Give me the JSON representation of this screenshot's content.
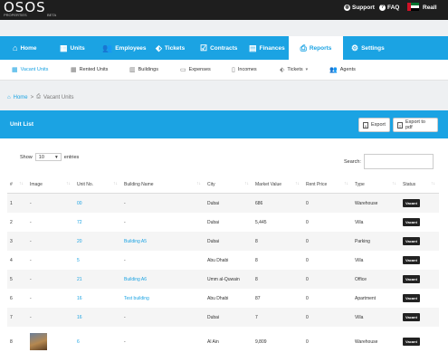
{
  "topbar": {
    "logo": "OSOS",
    "logo_sub": "PROPERTIES",
    "logo_badge": "BETA",
    "support": "Support",
    "faq": "FAQ",
    "user": "Reall"
  },
  "main_nav": [
    {
      "label": "Home",
      "icon": "home-icon"
    },
    {
      "label": "Units",
      "icon": "building-icon"
    },
    {
      "label": "Employees",
      "icon": "users-icon"
    },
    {
      "label": "Tickets",
      "icon": "tag-icon"
    },
    {
      "label": "Contracts",
      "icon": "clipboard-check-icon"
    },
    {
      "label": "Finances",
      "icon": "finance-icon"
    },
    {
      "label": "Reports",
      "icon": "printer-icon",
      "active": true
    },
    {
      "label": "Settings",
      "icon": "gear-icon"
    }
  ],
  "sub_nav": [
    {
      "label": "Vacant Units",
      "active": true
    },
    {
      "label": "Rented Units"
    },
    {
      "label": "Buildings"
    },
    {
      "label": "Expenses"
    },
    {
      "label": "Incomes"
    },
    {
      "label": "Tickets"
    },
    {
      "label": "Agents"
    }
  ],
  "breadcrumb": {
    "home": "Home",
    "separator": ">",
    "current": "Vacant Units"
  },
  "panel": {
    "title": "Unit List",
    "export_label": "Export",
    "export_pdf_label": "Export to pdf",
    "show_label": "Show",
    "entries_value": "10",
    "entries_label": "entries",
    "search_label": "Search:"
  },
  "table": {
    "headers": [
      "#",
      "Image",
      "Unit No.",
      "Building Name",
      "City",
      "Market Value",
      "Rent Price",
      "Type",
      "Status"
    ],
    "rows": [
      {
        "num": "1",
        "image": "-",
        "unit": "00",
        "building": "-",
        "city": "Dubai",
        "market": "686",
        "rent": "0",
        "type": "Warehouse",
        "status": "Vacant"
      },
      {
        "num": "2",
        "image": "-",
        "unit": "72",
        "building": "-",
        "city": "Dubai",
        "market": "5,445",
        "rent": "0",
        "type": "Villa",
        "status": "Vacant"
      },
      {
        "num": "3",
        "image": "-",
        "unit": "20",
        "building": "Building A5",
        "city": "Dubai",
        "market": "8",
        "rent": "0",
        "type": "Parking",
        "status": "Vacant"
      },
      {
        "num": "4",
        "image": "-",
        "unit": "5",
        "building": "-",
        "city": "Abu Dhabi",
        "market": "8",
        "rent": "0",
        "type": "Villa",
        "status": "Vacant"
      },
      {
        "num": "5",
        "image": "-",
        "unit": "21",
        "building": "Building A6",
        "city": "Umm al-Quwain",
        "market": "8",
        "rent": "0",
        "type": "Office",
        "status": "Vacant"
      },
      {
        "num": "6",
        "image": "-",
        "unit": "16",
        "building": "Test building",
        "city": "Abu Dhabi",
        "market": "87",
        "rent": "0",
        "type": "Apartment",
        "status": "Vacant"
      },
      {
        "num": "7",
        "image": "-",
        "unit": "16",
        "building": "-",
        "city": "Dubai",
        "market": "7",
        "rent": "0",
        "type": "Villa",
        "status": "Vacant"
      },
      {
        "num": "8",
        "image": "",
        "unit": "6",
        "building": "-",
        "city": "Al Ain",
        "market": "9,809",
        "rent": "0",
        "type": "Warehouse",
        "status": "Vacant"
      }
    ]
  },
  "colors": {
    "accent": "#1ba3e3",
    "topbar": "#1e1e1e",
    "badge": "#222222"
  }
}
